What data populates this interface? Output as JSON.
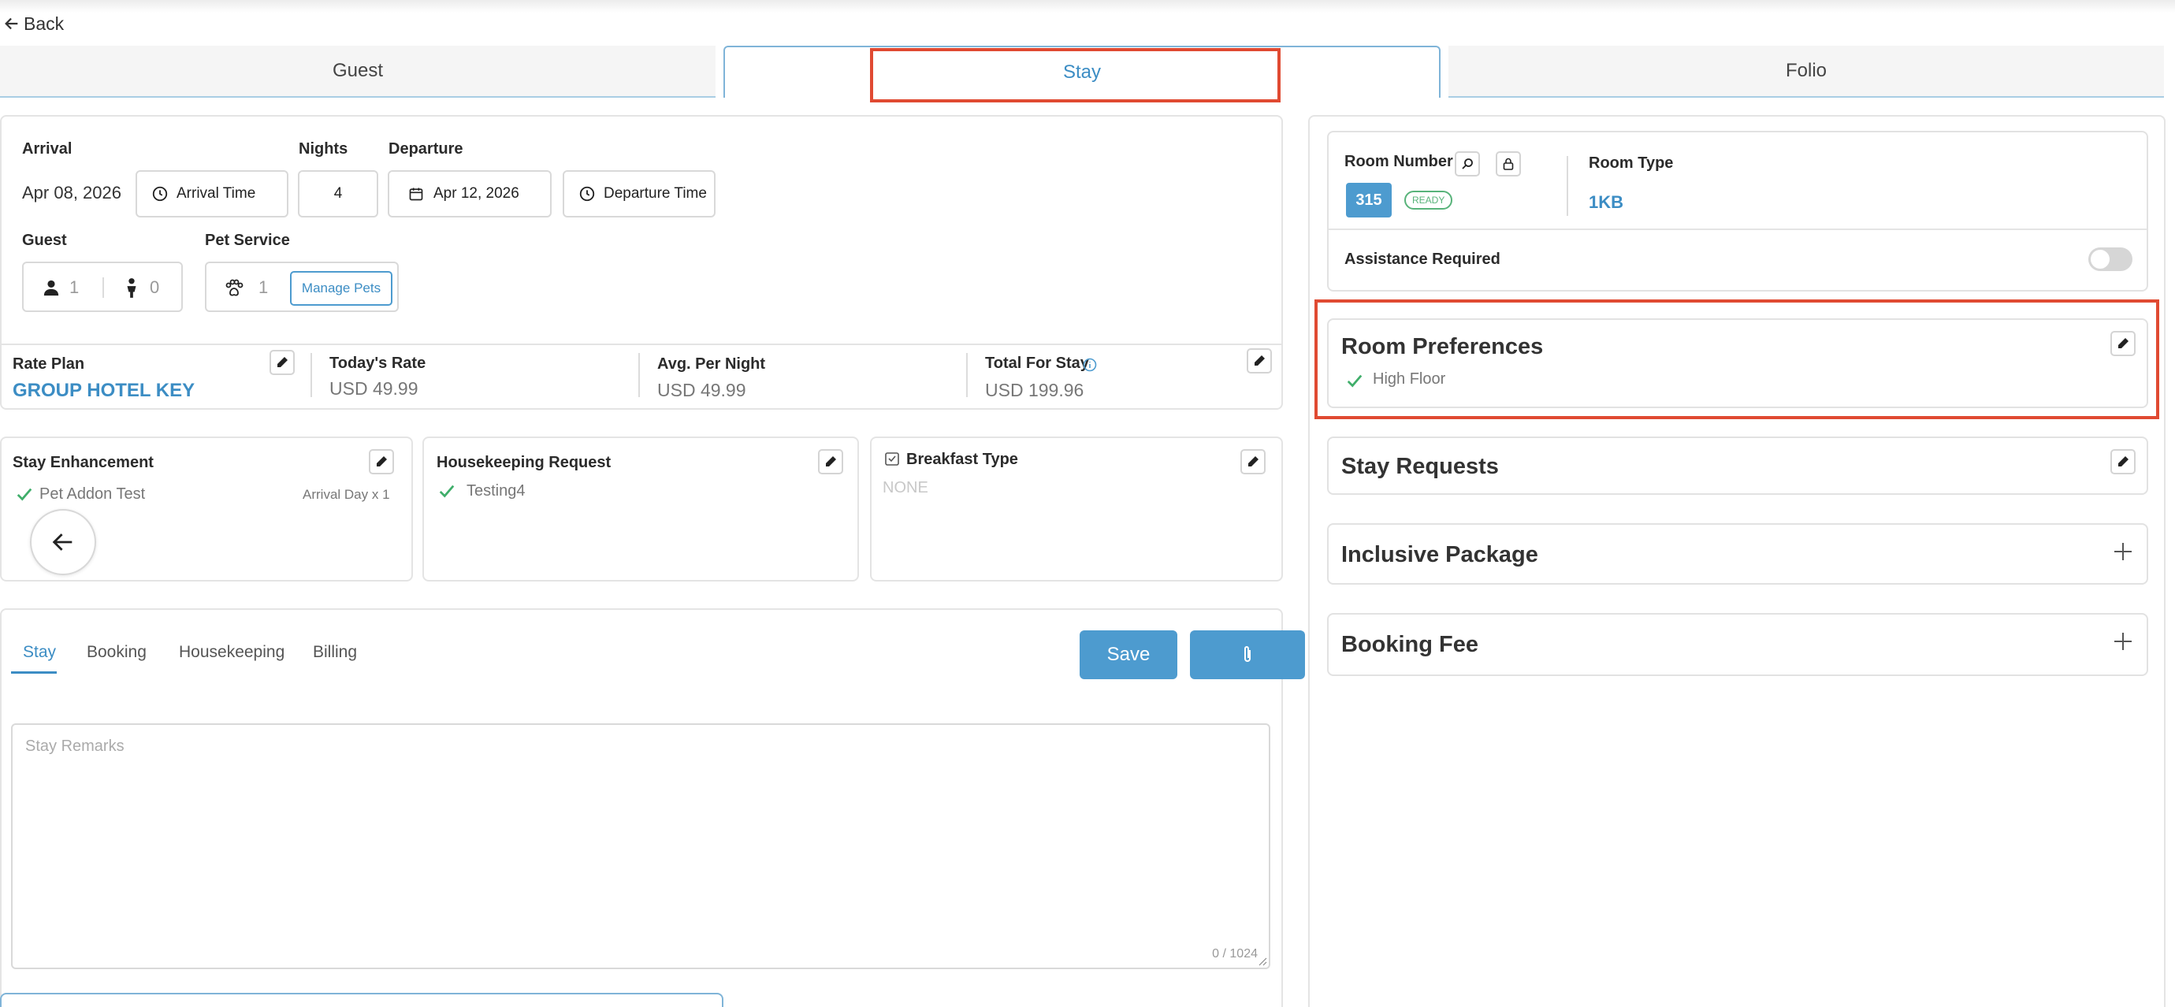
{
  "nav": {
    "back_label": "Back"
  },
  "tabs": [
    {
      "label": "Guest"
    },
    {
      "label": "Stay"
    },
    {
      "label": "Folio"
    }
  ],
  "stay": {
    "arrival_label": "Arrival",
    "arrival_date": "Apr 08, 2026",
    "arrival_time_label": "Arrival Time",
    "nights_label": "Nights",
    "nights_value": "4",
    "departure_label": "Departure",
    "departure_date": "Apr 12, 2026",
    "departure_time_label": "Departure Time",
    "guest_label": "Guest",
    "adults": "1",
    "children": "0",
    "pet_service_label": "Pet Service",
    "pets": "1",
    "manage_pets_label": "Manage Pets"
  },
  "rates": {
    "rate_plan_label": "Rate Plan",
    "rate_plan_value": "GROUP HOTEL KEY",
    "todays_rate_label": "Today's Rate",
    "todays_rate_value": "USD 49.99",
    "avg_label": "Avg. Per Night",
    "avg_value": "USD 49.99",
    "total_label": "Total For Stay",
    "total_value": "USD 199.96"
  },
  "enhancement": {
    "title": "Stay Enhancement",
    "item": "Pet Addon Test",
    "item_note": "Arrival Day x 1"
  },
  "housekeeping": {
    "title": "Housekeeping Request",
    "item": "Testing4"
  },
  "breakfast": {
    "title": "Breakfast Type",
    "value": "NONE"
  },
  "remarks": {
    "tabs": [
      "Stay",
      "Booking",
      "Housekeeping",
      "Billing"
    ],
    "save_label": "Save",
    "placeholder": "Stay Remarks",
    "counter": "0 / 1024"
  },
  "room": {
    "number_label": "Room Number",
    "number": "315",
    "status_badge": "READY",
    "type_label": "Room Type",
    "type_value": "1KB",
    "assistance_label": "Assistance Required",
    "assistance_on": false
  },
  "sections": {
    "room_preferences": {
      "title": "Room Preferences",
      "item": "High Floor"
    },
    "stay_requests": {
      "title": "Stay Requests"
    },
    "inclusive_package": {
      "title": "Inclusive Package"
    },
    "booking_fee": {
      "title": "Booking Fee"
    }
  },
  "colors": {
    "accent": "#3c8dc4",
    "highlight": "#e04a32",
    "success": "#3fae6a"
  }
}
